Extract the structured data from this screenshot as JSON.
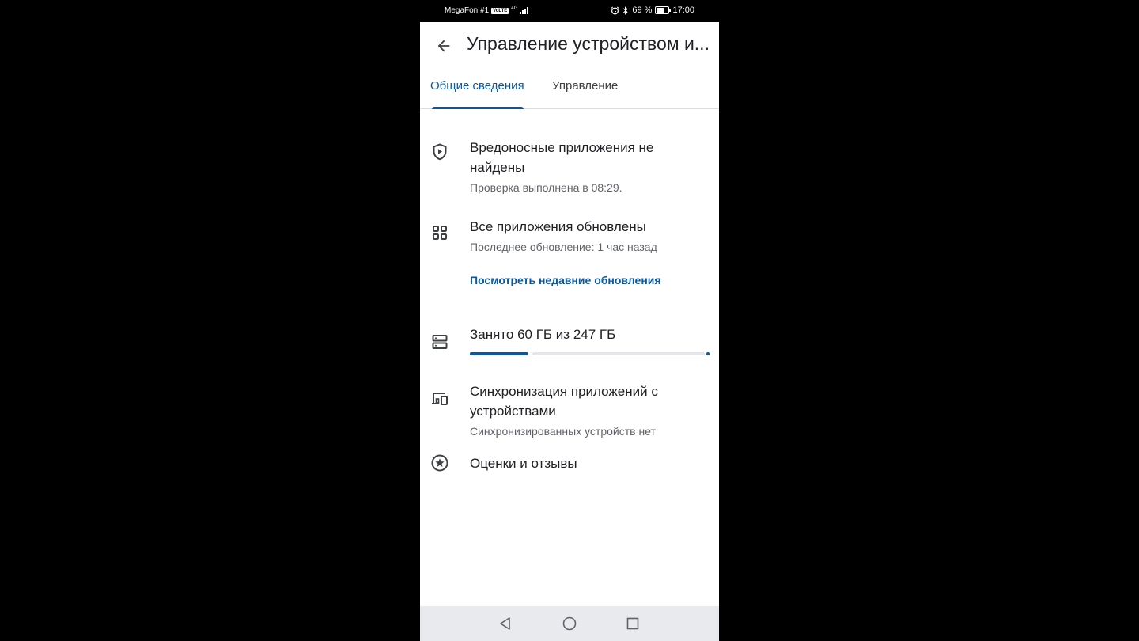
{
  "status_bar": {
    "carrier": "MegaFon #1",
    "volte": "VoLTE",
    "network": "4G",
    "battery_percent": "69 %",
    "battery_level": 0.69,
    "time": "17:00"
  },
  "app_bar": {
    "title": "Управление устройством и..."
  },
  "tabs": [
    {
      "label": "Общие сведения",
      "active": true
    },
    {
      "label": "Управление",
      "active": false
    }
  ],
  "items": {
    "malware": {
      "icon": "shield-play-icon",
      "title": "Вредоносные приложения не найдены",
      "subtitle": "Проверка выполнена в 08:29."
    },
    "updates": {
      "icon": "apps-grid-icon",
      "title": "Все приложения обновлены",
      "subtitle": "Последнее обновление: 1 час назад",
      "link": "Посмотреть недавние обновления"
    },
    "storage": {
      "icon": "storage-icon",
      "title": "Занято 60 ГБ из 247 ГБ",
      "used_gb": 60,
      "total_gb": 247
    },
    "sync": {
      "icon": "devices-icon",
      "title": "Синхронизация приложений с устройствами",
      "subtitle": "Синхронизированных устройств нет"
    },
    "ratings": {
      "icon": "star-circle-icon",
      "title": "Оценки и отзывы"
    }
  },
  "colors": {
    "accent": "#0b57a0",
    "text_primary": "#202124",
    "text_secondary": "#5f6368",
    "nav_bar": "#e8eaed"
  }
}
